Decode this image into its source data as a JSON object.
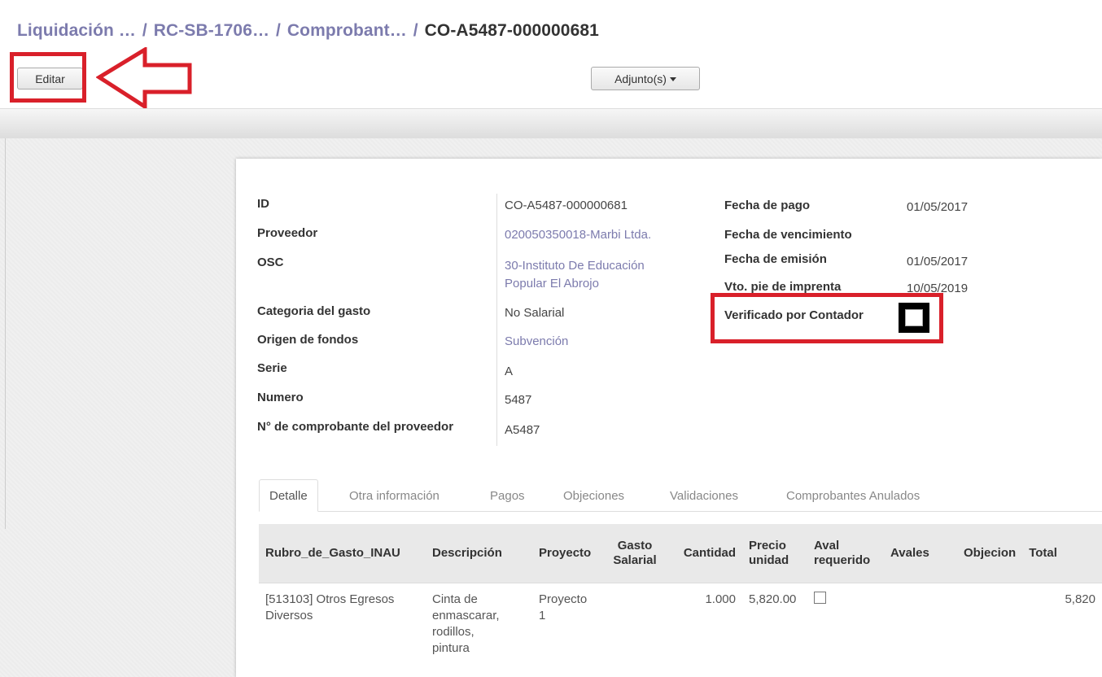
{
  "breadcrumb": {
    "items": [
      "Liquidación …",
      "RC-SB-1706…",
      "Comprobant…"
    ],
    "separator": "/",
    "current": "CO-A5487-000000681"
  },
  "toolbar": {
    "edit_label": "Editar",
    "attachments_label": "Adjunto(s)"
  },
  "form": {
    "left": [
      {
        "label": "ID",
        "value": "CO-A5487-000000681"
      },
      {
        "label": "Proveedor",
        "value": "020050350018-Marbi Ltda."
      },
      {
        "label": "OSC",
        "value_line1": "30-Instituto De Educación",
        "value_line2": "Popular El Abrojo"
      },
      {
        "label": "Categoria del gasto",
        "value": "No Salarial"
      },
      {
        "label": "Origen de fondos",
        "value": "Subvención"
      },
      {
        "label": "Serie",
        "value": "A"
      },
      {
        "label": "Numero",
        "value": "5487"
      },
      {
        "label": "N° de comprobante del proveedor",
        "value": "A5487"
      }
    ],
    "right": [
      {
        "label": "Fecha de pago",
        "value": "01/05/2017"
      },
      {
        "label": "Fecha de vencimiento",
        "value": ""
      },
      {
        "label": "Fecha de emisión",
        "value": "01/05/2017"
      },
      {
        "label": "Vto. pie de imprenta",
        "value": "10/05/2019"
      },
      {
        "label": "Verificado por Contador",
        "checked": false
      }
    ]
  },
  "tabs": [
    "Detalle",
    "Otra información",
    "Pagos",
    "Objeciones",
    "Validaciones",
    "Comprobantes Anulados"
  ],
  "table": {
    "headers": {
      "rubro": "Rubro_de_Gasto_INAU",
      "descripcion": "Descripción",
      "proyecto": "Proyecto",
      "gasto_l1": "Gasto",
      "gasto_l2": "Salarial",
      "cantidad": "Cantidad",
      "precio_l1": "Precio",
      "precio_l2": "unidad",
      "aval_l1": "Aval",
      "aval_l2": "requerido",
      "avales": "Avales",
      "objecion": "Objecion",
      "total": "Total"
    },
    "rows": [
      {
        "rubro_l1": "[513103] Otros Egresos",
        "rubro_l2": "Diversos",
        "desc_l1": "Cinta de",
        "desc_l2": "enmascarar,",
        "desc_l3": "rodillos,",
        "desc_l4": "pintura",
        "proyecto_l1": "Proyecto",
        "proyecto_l2": "1",
        "gasto": "",
        "cantidad": "1.000",
        "precio": "5,820.00",
        "aval_checked": false,
        "avales": "",
        "objecion": "",
        "total": "5,820"
      }
    ]
  },
  "colors": {
    "highlight": "#d9202a",
    "link": "#7c7bad"
  }
}
